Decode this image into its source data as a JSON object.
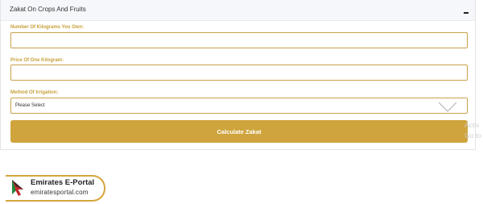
{
  "panel": {
    "title": "Zakat On Crops And Fruits",
    "collapse_icon": "minus-icon"
  },
  "form": {
    "kg_label": "Number Of Kilograms You Own:",
    "kg_value": "",
    "price_label": "Price Of One Kilogram:",
    "price_value": "",
    "method_label": "Method Of Irrigation:",
    "method_selected": "Please Select",
    "method_icon": "chevron-down-icon",
    "calculate_label": "Calculate Zakat"
  },
  "overlay": {
    "line1": "Activ",
    "line2": "Go to"
  },
  "logo": {
    "title": "Emirates E-Portal",
    "url": "emiratesportal.com",
    "icon": "cursor-arrow-icon"
  },
  "colors": {
    "accent": "#cfa43c",
    "label": "#c7a13a",
    "header_bg": "#f5f7fa",
    "logo_red": "#c0282d",
    "logo_green": "#1e8a3c"
  }
}
